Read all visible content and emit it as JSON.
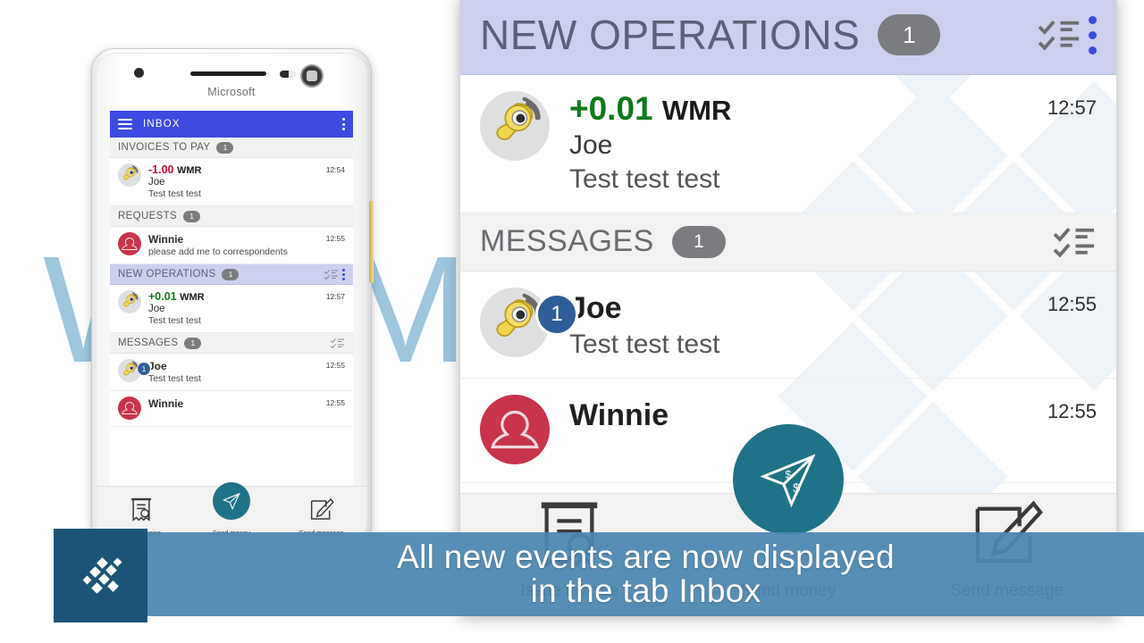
{
  "background": {
    "watermark_text": "WebMoney",
    "watermark_color": "#9ec6de"
  },
  "caption": {
    "line1": "All new events are now displayed",
    "line2": "in the tab Inbox",
    "bar_color": "#4b86b2",
    "text_color": "#ffffff"
  },
  "logo": {
    "name": "webmoney-logo",
    "background": "#1c5478"
  },
  "phone": {
    "brand": "Microsoft",
    "appbar": {
      "title": "INBOX",
      "color": "#3c4ae0"
    },
    "sections": [
      {
        "title": "INVOICES TO PAY",
        "badge": "1",
        "highlight": false,
        "has_checklist_icon": false,
        "has_kebab": false,
        "rows": [
          {
            "avatar": "webmoney-keeper-avatar",
            "amount": "-1.00",
            "amount_sign": "negative",
            "currency": "WMR",
            "name": "Joe",
            "subtitle": "Test test test",
            "time": "12:54",
            "unread": null
          }
        ]
      },
      {
        "title": "REQUESTS",
        "badge": "1",
        "highlight": false,
        "has_checklist_icon": false,
        "has_kebab": false,
        "rows": [
          {
            "avatar": "contact-avatar",
            "amount": null,
            "amount_sign": null,
            "currency": null,
            "name": "Winnie",
            "subtitle": "please add me to correspondents",
            "time": "12:55",
            "unread": null
          }
        ]
      },
      {
        "title": "NEW OPERATIONS",
        "badge": "1",
        "highlight": true,
        "has_checklist_icon": true,
        "has_kebab": true,
        "rows": [
          {
            "avatar": "webmoney-keeper-avatar",
            "amount": "+0.01",
            "amount_sign": "positive",
            "currency": "WMR",
            "name": "Joe",
            "subtitle": "Test test test",
            "time": "12:57",
            "unread": null
          }
        ]
      },
      {
        "title": "MESSAGES",
        "badge": "1",
        "highlight": false,
        "has_checklist_icon": true,
        "has_kebab": false,
        "rows": [
          {
            "avatar": "webmoney-keeper-avatar",
            "amount": null,
            "amount_sign": null,
            "currency": null,
            "name": "Joe",
            "subtitle": "Test test test",
            "time": "12:55",
            "unread": "1"
          },
          {
            "avatar": "contact-avatar",
            "amount": null,
            "amount_sign": null,
            "currency": null,
            "name": "Winnie",
            "subtitle": "",
            "time": "12:55",
            "unread": null
          }
        ]
      }
    ],
    "toolbar": [
      {
        "icon": "invoice-icon",
        "label": "Issue invoice",
        "primary": false
      },
      {
        "icon": "send-money-icon",
        "label": "Send money",
        "primary": true
      },
      {
        "icon": "send-message-icon",
        "label": "Send message",
        "primary": false
      }
    ]
  },
  "panel": {
    "sections": [
      {
        "title": "NEW OPERATIONS",
        "badge": "1",
        "highlight": true,
        "has_checklist_icon": true,
        "has_kebab": true,
        "rows": [
          {
            "avatar": "webmoney-keeper-avatar",
            "amount": "+0.01",
            "amount_sign": "positive",
            "currency": "WMR",
            "name": "Joe",
            "subtitle": "Test test test",
            "time": "12:57",
            "unread": null
          }
        ]
      },
      {
        "title": "MESSAGES",
        "badge": "1",
        "highlight": false,
        "has_checklist_icon": true,
        "has_kebab": false,
        "rows": [
          {
            "avatar": "webmoney-keeper-avatar",
            "amount": null,
            "amount_sign": null,
            "currency": null,
            "name": "Joe",
            "subtitle": "Test test test",
            "time": "12:55",
            "unread": "1"
          },
          {
            "avatar": "contact-avatar",
            "amount": null,
            "amount_sign": null,
            "currency": null,
            "name": "Winnie",
            "subtitle": "",
            "time": "12:55",
            "unread": null
          }
        ]
      }
    ],
    "toolbar": [
      {
        "icon": "invoice-icon",
        "label": "Issue invoice",
        "primary": false
      },
      {
        "icon": "send-money-icon",
        "label": "Send money",
        "primary": true
      },
      {
        "icon": "send-message-icon",
        "label": "Send message",
        "primary": false
      }
    ]
  },
  "colors": {
    "accent_blue": "#3c4ae0",
    "lavender_header": "#ccd0ec",
    "positive_green": "#0f7a1d",
    "negative_red": "#c60e2e",
    "teal": "#1f7287",
    "avatar_red": "#c8344c"
  }
}
